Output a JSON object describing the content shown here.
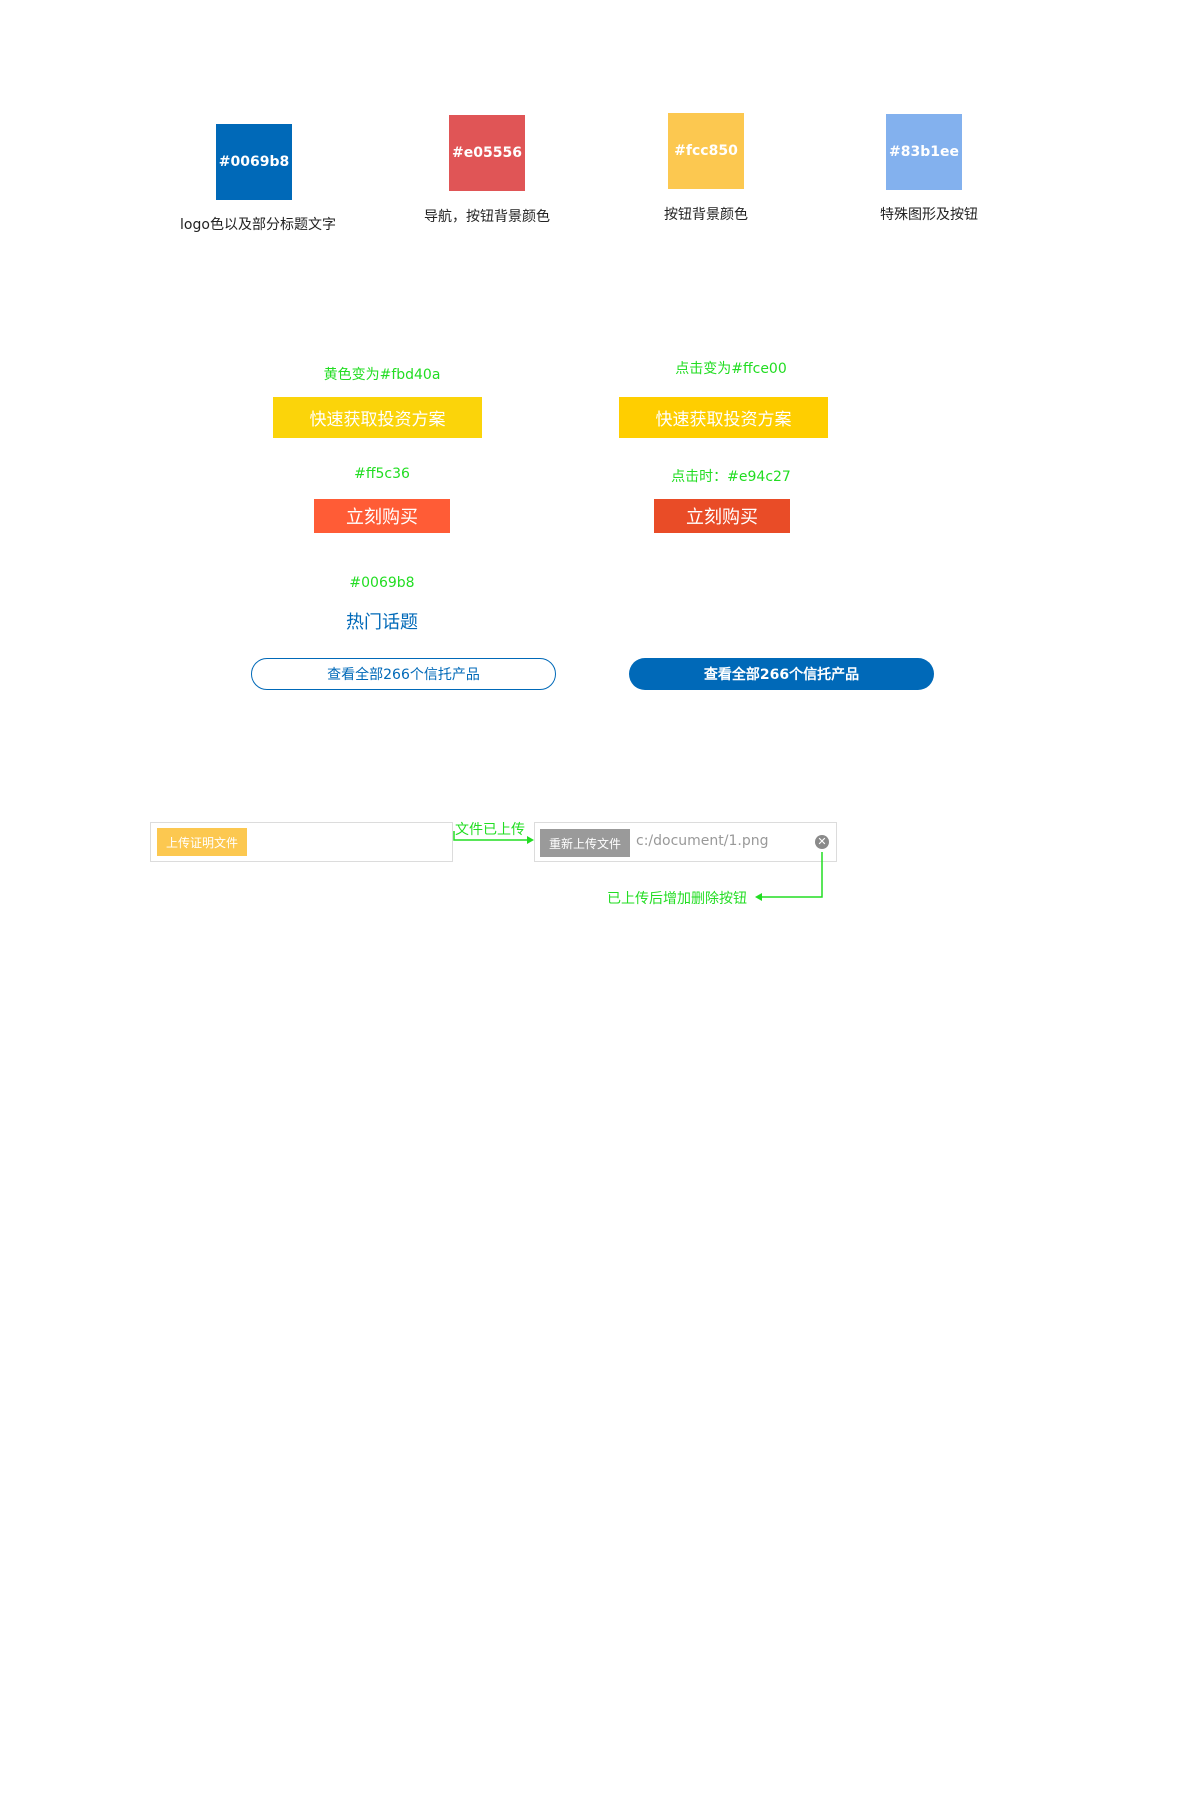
{
  "palette": {
    "swatches": [
      {
        "hex_label": "#0069b8",
        "color": "#0069b8",
        "caption": "logo色以及部分标题文字"
      },
      {
        "hex_label": "#e05556",
        "color": "#e05556",
        "caption": "导航，按钮背景颜色"
      },
      {
        "hex_label": "#fcc850",
        "color": "#fcc850",
        "caption": "按钮背景颜色"
      },
      {
        "hex_label": "#83b1ee",
        "color": "#83b1ee",
        "caption": "特殊图形及按钮"
      }
    ]
  },
  "buttons": {
    "yellow_normal": {
      "note": "黄色变为#fbd40a",
      "label": "快速获取投资方案",
      "color": "#fbd40a"
    },
    "yellow_active": {
      "note": "点击变为#ffce00",
      "label": "快速获取投资方案",
      "color": "#ffce00"
    },
    "red_normal": {
      "note": "#ff5c36",
      "label": "立刻购买",
      "color": "#ff5c36"
    },
    "red_active": {
      "note": "点击时：#e94c27",
      "label": "立刻购买",
      "color": "#e94c27"
    },
    "hot_topic": {
      "note": "#0069b8",
      "label": "热门话题",
      "color": "#0069b8"
    },
    "pill_outline": {
      "label": "查看全部266个信托产品",
      "color": "#0069b8"
    },
    "pill_filled": {
      "label": "查看全部266个信托产品",
      "color": "#0069b8"
    }
  },
  "upload": {
    "initial_button": "上传证明文件",
    "initial_button_color": "#fcc850",
    "arrow_note": "文件已上传",
    "reupload_button": "重新上传文件",
    "reupload_button_color": "#9a9a9a",
    "file_path": "c:/document/1.png",
    "delete_note": "已上传后增加删除按钮",
    "close_icon": "close-circle-icon"
  },
  "annotation_color": "#22dd22"
}
